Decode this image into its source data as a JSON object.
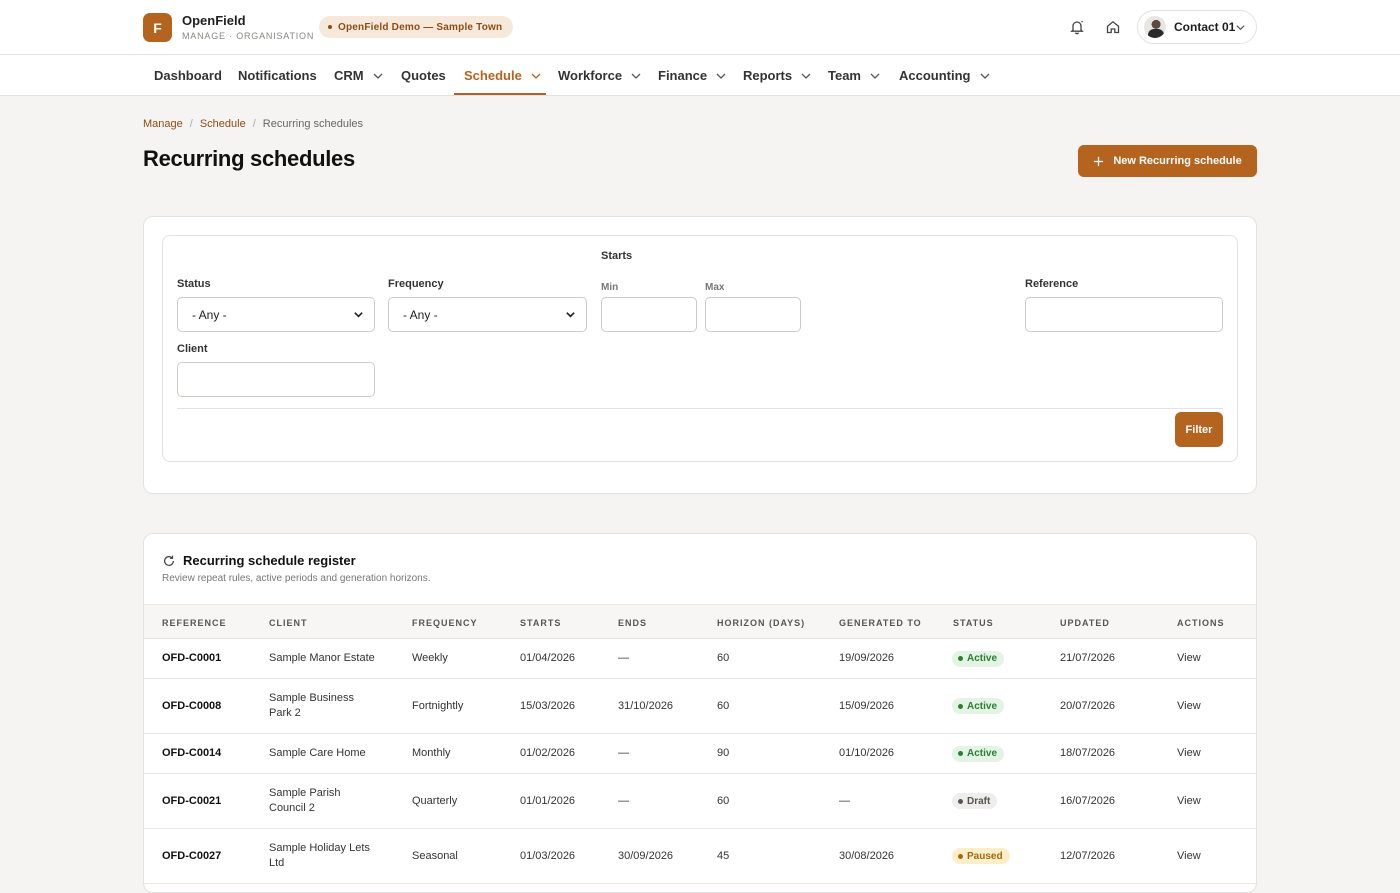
{
  "brand": {
    "logo_letter": "F",
    "name": "OpenField",
    "subtitle": "MANAGE · ORGANISATION"
  },
  "org_pill": {
    "label": "OpenField Demo — Sample Town"
  },
  "header_icons": [
    "bell-icon",
    "home-icon"
  ],
  "user": {
    "name": "Contact 01"
  },
  "nav": [
    {
      "label": "Dashboard",
      "dropdown": false
    },
    {
      "label": "Notifications",
      "dropdown": false
    },
    {
      "label": "CRM",
      "dropdown": true
    },
    {
      "label": "Quotes",
      "dropdown": false
    },
    {
      "label": "Schedule",
      "dropdown": true,
      "active": true
    },
    {
      "label": "Workforce",
      "dropdown": true
    },
    {
      "label": "Finance",
      "dropdown": true
    },
    {
      "label": "Reports",
      "dropdown": true
    },
    {
      "label": "Team",
      "dropdown": true
    },
    {
      "label": "Accounting",
      "dropdown": true
    }
  ],
  "breadcrumb": {
    "items": [
      "Manage",
      "Schedule",
      "Recurring schedules"
    ],
    "separator": "/"
  },
  "page": {
    "title": "Recurring schedules",
    "new_button": "New Recurring schedule"
  },
  "filters": {
    "status": {
      "label": "Status",
      "value": "- Any -"
    },
    "frequency": {
      "label": "Frequency",
      "value": "- Any -"
    },
    "starts": {
      "label": "Starts",
      "min_label": "Min",
      "max_label": "Max"
    },
    "reference": {
      "label": "Reference"
    },
    "client": {
      "label": "Client"
    },
    "submit": "Filter"
  },
  "register": {
    "title": "Recurring schedule register",
    "subtitle": "Review repeat rules, active periods and generation horizons.",
    "columns": [
      "REFERENCE",
      "CLIENT",
      "FREQUENCY",
      "STARTS",
      "ENDS",
      "HORIZON (DAYS)",
      "GENERATED TO",
      "STATUS",
      "UPDATED",
      "ACTIONS"
    ],
    "rows": [
      {
        "reference": "OFD-C0001",
        "client": [
          "Sample Manor Estate"
        ],
        "frequency": "Weekly",
        "starts": "01/04/2026",
        "ends": "—",
        "horizon": "60",
        "generated_to": "19/09/2026",
        "status": "Active",
        "status_kind": "active",
        "updated": "21/07/2026",
        "action": "View"
      },
      {
        "reference": "OFD-C0008",
        "client": [
          "Sample Business",
          "Park 2"
        ],
        "frequency": "Fortnightly",
        "starts": "15/03/2026",
        "ends": "31/10/2026",
        "horizon": "60",
        "generated_to": "15/09/2026",
        "status": "Active",
        "status_kind": "active",
        "updated": "20/07/2026",
        "action": "View"
      },
      {
        "reference": "OFD-C0014",
        "client": [
          "Sample Care Home"
        ],
        "frequency": "Monthly",
        "starts": "01/02/2026",
        "ends": "—",
        "horizon": "90",
        "generated_to": "01/10/2026",
        "status": "Active",
        "status_kind": "active",
        "updated": "18/07/2026",
        "action": "View"
      },
      {
        "reference": "OFD-C0021",
        "client": [
          "Sample Parish",
          "Council 2"
        ],
        "frequency": "Quarterly",
        "starts": "01/01/2026",
        "ends": "—",
        "horizon": "60",
        "generated_to": "—",
        "status": "Draft",
        "status_kind": "draft",
        "updated": "16/07/2026",
        "action": "View"
      },
      {
        "reference": "OFD-C0027",
        "client": [
          "Sample Holiday Lets",
          "Ltd"
        ],
        "frequency": "Seasonal",
        "starts": "01/03/2026",
        "ends": "30/09/2026",
        "horizon": "45",
        "generated_to": "30/08/2026",
        "status": "Paused",
        "status_kind": "paused",
        "updated": "12/07/2026",
        "action": "View"
      }
    ]
  },
  "colors": {
    "accent": "#b4641f",
    "active": "#2e7d32",
    "paused": "#a8650b"
  }
}
